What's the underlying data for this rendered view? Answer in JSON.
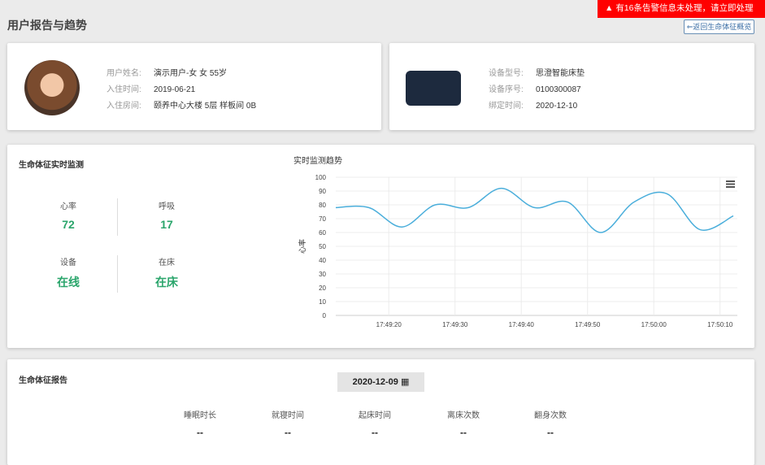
{
  "header": {
    "title": "用户报告与趋势",
    "back_label": "⇐返回生命体征概览"
  },
  "alert": {
    "text": "有16条告警信息未处理，请立即处理",
    "icon": "warning-icon",
    "color": "#ff0000"
  },
  "user": {
    "fields": [
      {
        "label": "用户姓名:",
        "value": "演示用户-女  女  55岁"
      },
      {
        "label": "入住时间:",
        "value": "2019-06-21"
      },
      {
        "label": "入住房间:",
        "value": "颐养中心大楼 5层 样板间 0B"
      }
    ]
  },
  "device": {
    "fields": [
      {
        "label": "设备型号:",
        "value": "思澄智能床垫"
      },
      {
        "label": "设备序号:",
        "value": "0100300087"
      },
      {
        "label": "绑定时间:",
        "value": "2020-12-10"
      }
    ]
  },
  "vitals": {
    "title": "生命体征实时监测",
    "metrics": [
      {
        "label": "心率",
        "value": "72"
      },
      {
        "label": "呼吸",
        "value": "17"
      },
      {
        "label": "设备",
        "value": "在线"
      },
      {
        "label": "在床",
        "value": "在床"
      }
    ],
    "accent": "#2aa56b"
  },
  "chart_data": {
    "type": "line",
    "title": "实时监测趋势",
    "ylabel": "心率",
    "xlabel": "",
    "ylim": [
      0,
      100
    ],
    "yticks": [
      0,
      10,
      20,
      30,
      40,
      50,
      60,
      70,
      80,
      90,
      100
    ],
    "xticks": [
      "17:49:20",
      "17:49:30",
      "17:49:40",
      "17:49:50",
      "17:50:00",
      "17:50:10"
    ],
    "x": [
      "17:49:12",
      "17:49:17",
      "17:49:22",
      "17:49:27",
      "17:49:32",
      "17:49:37",
      "17:49:42",
      "17:49:47",
      "17:49:52",
      "17:49:57",
      "17:50:02",
      "17:50:07",
      "17:50:12"
    ],
    "values": [
      78,
      78,
      64,
      80,
      78,
      92,
      78,
      82,
      60,
      82,
      88,
      62,
      72
    ],
    "grid": true,
    "color": "#4aaedb",
    "menu_icon": "hamburger-menu-icon"
  },
  "report": {
    "title": "生命体征报告",
    "date": "2020-12-09",
    "date_icon": "calendar-icon",
    "items": [
      {
        "label": "睡眠时长",
        "value": "--"
      },
      {
        "label": "就寝时间",
        "value": "--"
      },
      {
        "label": "起床时间",
        "value": "--"
      },
      {
        "label": "离床次数",
        "value": "--"
      },
      {
        "label": "翻身次数",
        "value": "--"
      }
    ]
  }
}
